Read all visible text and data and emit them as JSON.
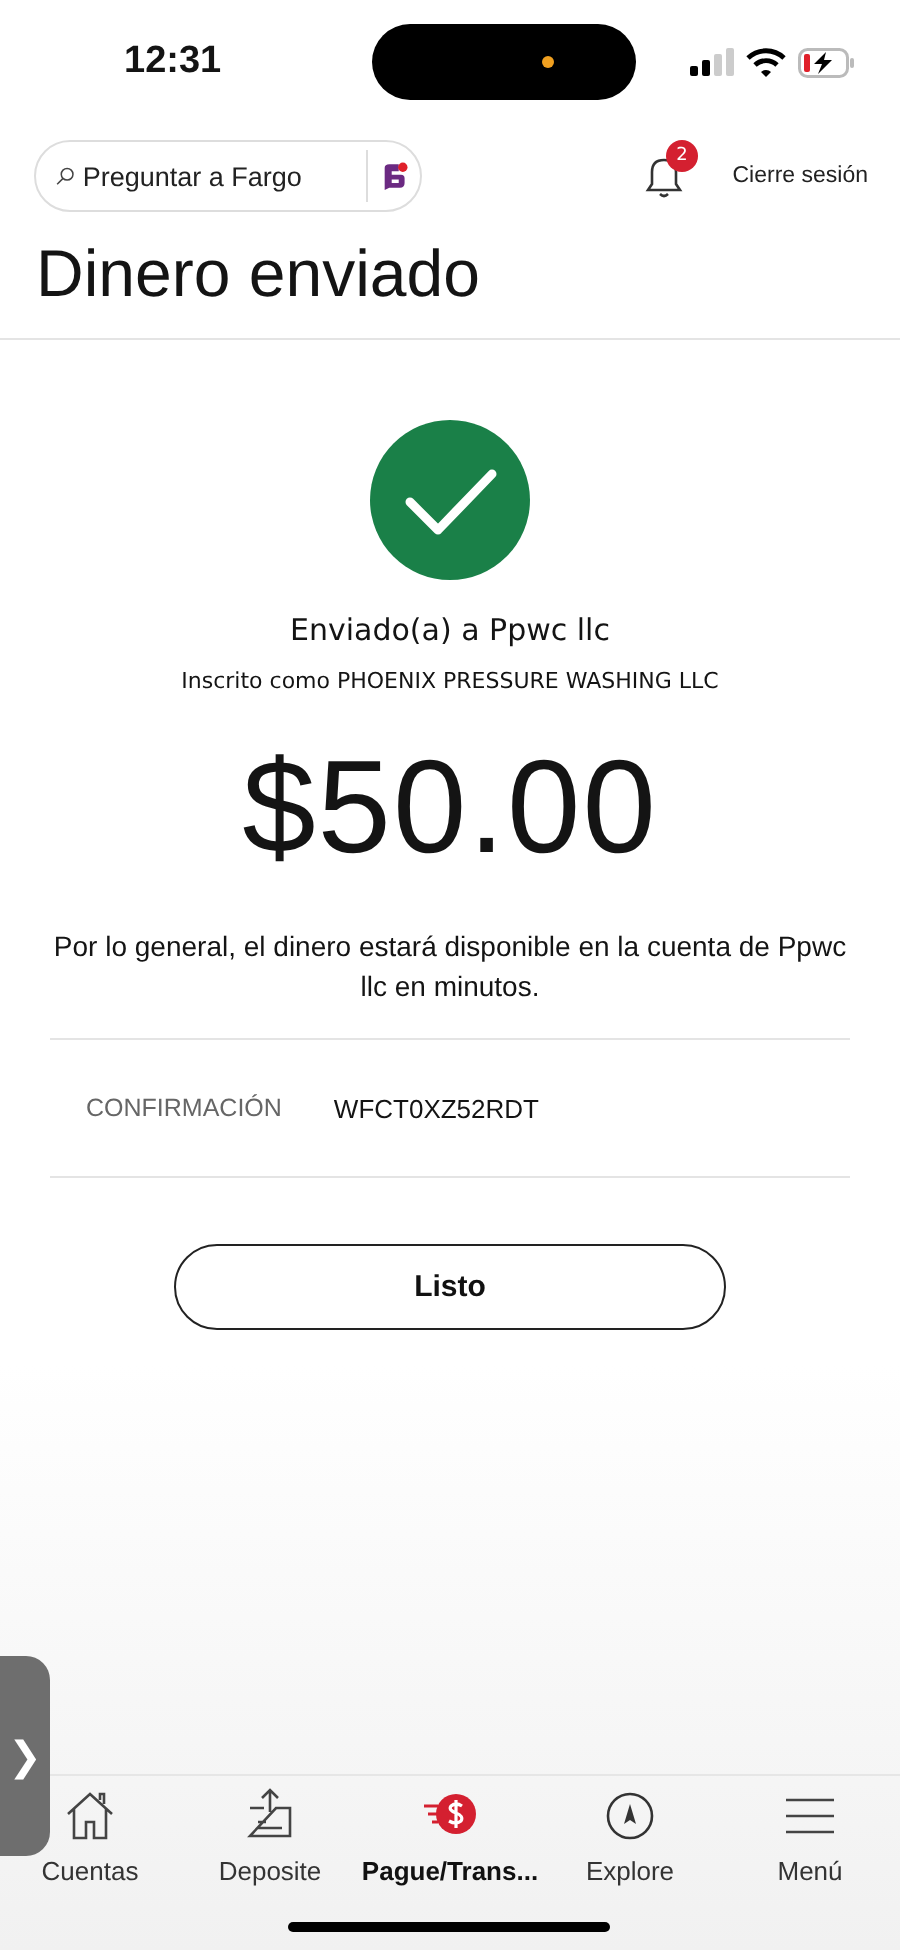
{
  "status_bar": {
    "time": "12:31"
  },
  "header": {
    "search": {
      "placeholder": "Preguntar a Fargo"
    },
    "notifications": {
      "count": "2"
    },
    "logout": "Cierre sesión"
  },
  "title": "Dinero enviado",
  "result": {
    "recipient": "Enviado(a) a Ppwc llc",
    "enrolled_as": "Inscrito como PHOENIX PRESSURE WASHING LLC",
    "amount": "$50.00",
    "note": "Por lo general, el dinero estará disponible en la cuenta de Ppwc llc en minutos.",
    "confirmation": {
      "label": "CONFIRMACIÓN",
      "value": "WFCT0XZ52RDT"
    },
    "done_button": "Listo"
  },
  "side_handle": "❯",
  "bottom_nav": [
    {
      "kind": "home",
      "label": "Cuentas",
      "selected": false
    },
    {
      "kind": "deposit",
      "label": "Deposite",
      "selected": false
    },
    {
      "kind": "pay",
      "label": "Pague/Trans...",
      "selected": true
    },
    {
      "kind": "explore",
      "label": "Explore",
      "selected": false
    },
    {
      "kind": "menu",
      "label": "Menú",
      "selected": false
    }
  ]
}
